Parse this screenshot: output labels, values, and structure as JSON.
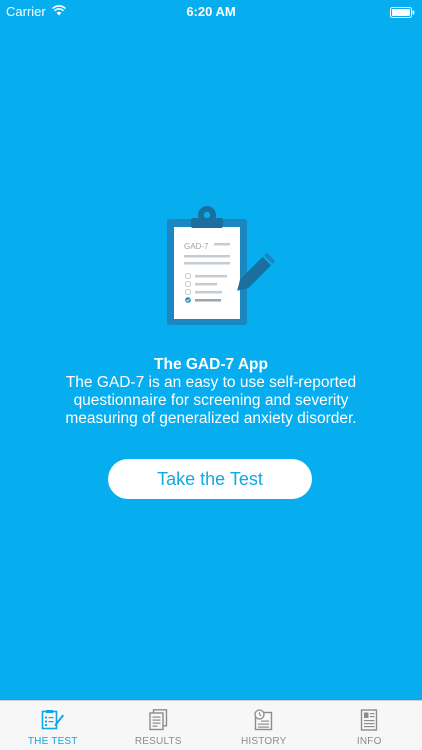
{
  "status_bar": {
    "carrier": "Carrier",
    "time": "6:20 AM"
  },
  "illustration": {
    "clipboard_label": "GAD-7",
    "icon": "clipboard-pencil-icon"
  },
  "hero": {
    "title": "The GAD-7 App",
    "description": "The GAD-7 is an easy to use self-reported questionnaire for screening and severity measuring of generalized anxiety disorder."
  },
  "cta": {
    "label": "Take the Test"
  },
  "tabs": [
    {
      "label": "THE TEST",
      "icon": "test-icon",
      "active": true
    },
    {
      "label": "RESULTS",
      "icon": "results-icon",
      "active": false
    },
    {
      "label": "HISTORY",
      "icon": "history-icon",
      "active": false
    },
    {
      "label": "INFO",
      "icon": "info-icon",
      "active": false
    }
  ],
  "colors": {
    "background": "#06aeef",
    "button_text": "#11a8e4",
    "tab_active": "#0aa6e8",
    "tab_inactive": "#8c8c8c"
  }
}
